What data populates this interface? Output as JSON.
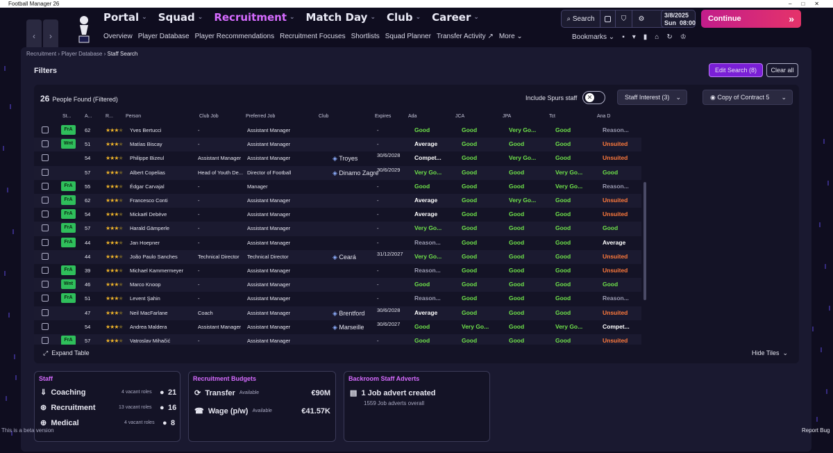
{
  "window": {
    "title": "Football Manager 26"
  },
  "nav": {
    "main": [
      "Portal",
      "Squad",
      "Recruitment",
      "Match Day",
      "Club",
      "Career"
    ],
    "active": "Recruitment",
    "sub": [
      "Overview",
      "Player Database",
      "Player Recommendations",
      "Recruitment Focuses",
      "Shortlists",
      "Squad Planner",
      "Transfer Activity",
      "More"
    ]
  },
  "top": {
    "search_label": "Search",
    "date": "3/8/2025",
    "day": "Sun",
    "time": "08:00",
    "continue_label": "Continue",
    "bookmarks_label": "Bookmarks"
  },
  "breadcrumb": [
    "Recruitment",
    "Player Database",
    "Staff Search"
  ],
  "filters": {
    "title": "Filters",
    "edit_search": "Edit Search (8)",
    "clear_all": "Clear all"
  },
  "results": {
    "count": "26",
    "count_label": "People Found (Filtered)",
    "include_label": "Include Spurs staff",
    "dropdown_interest": "Staff Interest (3)",
    "dropdown_view": "Copy of Contract 5",
    "columns": [
      "St...",
      "A...",
      "R...",
      "Person",
      "Club Job",
      "Preferred Job",
      "Club",
      "Expires",
      "Ada",
      "JCA",
      "JPA",
      "Tct",
      "Ana D"
    ],
    "rows": [
      {
        "tag": "FrA",
        "age": "62",
        "stars": 3,
        "person": "Yves Bertucci",
        "club_job": "-",
        "pref_job": "Assistant Manager",
        "club": "",
        "expires": "-",
        "ada": [
          "Good",
          "g"
        ],
        "jca": [
          "Good",
          "g"
        ],
        "jpa": [
          "Very Go...",
          "g"
        ],
        "tct": [
          "Good",
          "g"
        ],
        "ana": [
          "Reason...",
          "n"
        ]
      },
      {
        "tag": "Wnt",
        "age": "51",
        "stars": 3,
        "person": "Matías Biscay",
        "club_job": "-",
        "pref_job": "Assistant Manager",
        "club": "",
        "expires": "-",
        "ada": [
          "Average",
          "w"
        ],
        "jca": [
          "Good",
          "g"
        ],
        "jpa": [
          "Good",
          "g"
        ],
        "tct": [
          "Good",
          "g"
        ],
        "ana": [
          "Unsuited",
          "o"
        ]
      },
      {
        "tag": "",
        "age": "54",
        "stars": 3,
        "person": "Philippe Bizeul",
        "club_job": "Assistant Manager",
        "pref_job": "Assistant Manager",
        "club": "Troyes",
        "expires": "30/6/2028",
        "ada": [
          "Compet...",
          "w"
        ],
        "jca": [
          "Good",
          "g"
        ],
        "jpa": [
          "Very Go...",
          "g"
        ],
        "tct": [
          "Good",
          "g"
        ],
        "ana": [
          "Unsuited",
          "o"
        ]
      },
      {
        "tag": "",
        "age": "57",
        "stars": 3,
        "person": "Albert Copelias",
        "club_job": "Head of Youth De...",
        "pref_job": "Director of Football",
        "club": "Dinamo Zagre",
        "expires": "30/6/2029",
        "ada": [
          "Very Go...",
          "g"
        ],
        "jca": [
          "Good",
          "g"
        ],
        "jpa": [
          "Good",
          "g"
        ],
        "tct": [
          "Very Go...",
          "g"
        ],
        "ana": [
          "Good",
          "g"
        ]
      },
      {
        "tag": "FrA",
        "age": "55",
        "stars": 3,
        "person": "Édgar Carvajal",
        "club_job": "-",
        "pref_job": "Manager",
        "club": "",
        "expires": "-",
        "ada": [
          "Good",
          "g"
        ],
        "jca": [
          "Good",
          "g"
        ],
        "jpa": [
          "Good",
          "g"
        ],
        "tct": [
          "Very Go...",
          "g"
        ],
        "ana": [
          "Reason...",
          "n"
        ]
      },
      {
        "tag": "FrA",
        "age": "62",
        "stars": 3,
        "person": "Francesco Conti",
        "club_job": "-",
        "pref_job": "Assistant Manager",
        "club": "",
        "expires": "-",
        "ada": [
          "Average",
          "w"
        ],
        "jca": [
          "Good",
          "g"
        ],
        "jpa": [
          "Very Go...",
          "g"
        ],
        "tct": [
          "Good",
          "g"
        ],
        "ana": [
          "Unsuited",
          "o"
        ]
      },
      {
        "tag": "FrA",
        "age": "54",
        "stars": 3,
        "person": "Mickaël Debève",
        "club_job": "-",
        "pref_job": "Assistant Manager",
        "club": "",
        "expires": "-",
        "ada": [
          "Average",
          "w"
        ],
        "jca": [
          "Good",
          "g"
        ],
        "jpa": [
          "Good",
          "g"
        ],
        "tct": [
          "Good",
          "g"
        ],
        "ana": [
          "Unsuited",
          "o"
        ]
      },
      {
        "tag": "FrA",
        "age": "57",
        "stars": 3,
        "person": "Harald Gämperle",
        "club_job": "-",
        "pref_job": "Assistant Manager",
        "club": "",
        "expires": "-",
        "ada": [
          "Very Go...",
          "g"
        ],
        "jca": [
          "Good",
          "g"
        ],
        "jpa": [
          "Good",
          "g"
        ],
        "tct": [
          "Good",
          "g"
        ],
        "ana": [
          "Good",
          "g"
        ]
      },
      {
        "tag": "FrA",
        "age": "44",
        "stars": 3,
        "person": "Jan Hoepner",
        "club_job": "-",
        "pref_job": "Assistant Manager",
        "club": "",
        "expires": "-",
        "ada": [
          "Reason...",
          "n"
        ],
        "jca": [
          "Good",
          "g"
        ],
        "jpa": [
          "Good",
          "g"
        ],
        "tct": [
          "Good",
          "g"
        ],
        "ana": [
          "Average",
          "w"
        ]
      },
      {
        "tag": "",
        "age": "44",
        "stars": 3,
        "person": "João Paulo Sanches",
        "club_job": "Technical Director",
        "pref_job": "Technical Director",
        "club": "Ceará",
        "expires": "31/12/2027",
        "ada": [
          "Very Go...",
          "g"
        ],
        "jca": [
          "Good",
          "g"
        ],
        "jpa": [
          "Good",
          "g"
        ],
        "tct": [
          "Good",
          "g"
        ],
        "ana": [
          "Unsuited",
          "o"
        ]
      },
      {
        "tag": "FrA",
        "age": "39",
        "stars": 3,
        "person": "Michael Kammermeyer",
        "club_job": "-",
        "pref_job": "Assistant Manager",
        "club": "",
        "expires": "-",
        "ada": [
          "Reason...",
          "n"
        ],
        "jca": [
          "Good",
          "g"
        ],
        "jpa": [
          "Good",
          "g"
        ],
        "tct": [
          "Good",
          "g"
        ],
        "ana": [
          "Unsuited",
          "o"
        ]
      },
      {
        "tag": "Wnt",
        "age": "46",
        "stars": 3,
        "person": "Marco Knoop",
        "club_job": "-",
        "pref_job": "Assistant Manager",
        "club": "",
        "expires": "-",
        "ada": [
          "Good",
          "g"
        ],
        "jca": [
          "Good",
          "g"
        ],
        "jpa": [
          "Good",
          "g"
        ],
        "tct": [
          "Good",
          "g"
        ],
        "ana": [
          "Good",
          "g"
        ]
      },
      {
        "tag": "FrA",
        "age": "51",
        "stars": 3,
        "person": "Levent Şahin",
        "club_job": "-",
        "pref_job": "Assistant Manager",
        "club": "",
        "expires": "-",
        "ada": [
          "Reason...",
          "n"
        ],
        "jca": [
          "Good",
          "g"
        ],
        "jpa": [
          "Good",
          "g"
        ],
        "tct": [
          "Good",
          "g"
        ],
        "ana": [
          "Reason...",
          "n"
        ]
      },
      {
        "tag": "",
        "age": "47",
        "stars": 3,
        "person": "Neil MacFarlane",
        "club_job": "Coach",
        "pref_job": "Assistant Manager",
        "club": "Brentford",
        "expires": "30/6/2028",
        "ada": [
          "Average",
          "w"
        ],
        "jca": [
          "Good",
          "g"
        ],
        "jpa": [
          "Good",
          "g"
        ],
        "tct": [
          "Good",
          "g"
        ],
        "ana": [
          "Unsuited",
          "o"
        ]
      },
      {
        "tag": "",
        "age": "54",
        "stars": 3,
        "person": "Andrea Maldera",
        "club_job": "Assistant Manager",
        "pref_job": "Assistant Manager",
        "club": "Marseille",
        "expires": "30/6/2027",
        "ada": [
          "Good",
          "g"
        ],
        "jca": [
          "Very Go...",
          "g"
        ],
        "jpa": [
          "Good",
          "g"
        ],
        "tct": [
          "Very Go...",
          "g"
        ],
        "ana": [
          "Compet...",
          "w"
        ]
      },
      {
        "tag": "FrA",
        "age": "57",
        "stars": 3,
        "person": "Vatroslav Mihačić",
        "club_job": "-",
        "pref_job": "Assistant Manager",
        "club": "",
        "expires": "-",
        "ada": [
          "Good",
          "g"
        ],
        "jca": [
          "Good",
          "g"
        ],
        "jpa": [
          "Good",
          "g"
        ],
        "tct": [
          "Good",
          "g"
        ],
        "ana": [
          "Unsuited",
          "o"
        ]
      }
    ],
    "expand_label": "Expand Table",
    "hide_tiles_label": "Hide Tiles"
  },
  "tiles": {
    "staff": {
      "title": "Staff",
      "lines": [
        {
          "label": "Coaching",
          "sub": "4 vacant roles",
          "value": "21"
        },
        {
          "label": "Recruitment",
          "sub": "13 vacant roles",
          "value": "16"
        },
        {
          "label": "Medical",
          "sub": "4 vacant roles",
          "value": "8"
        }
      ]
    },
    "budgets": {
      "title": "Recruitment Budgets",
      "transfer_label": "Transfer",
      "transfer_sub": "Available",
      "transfer_value": "€90M",
      "wage_label": "Wage (p/w)",
      "wage_sub": "Available",
      "wage_value": "€41.57K"
    },
    "adverts": {
      "title": "Backroom Staff Adverts",
      "main": "1 Job advert created",
      "sub": "1559 Job adverts overall"
    }
  },
  "footer": {
    "beta": "This is a beta version",
    "report": "Report Bug"
  },
  "colors": {
    "accent": "#d66bff",
    "continue": "#e5336a",
    "good": "#6fe24a",
    "unsuited": "#ff7a3c"
  }
}
